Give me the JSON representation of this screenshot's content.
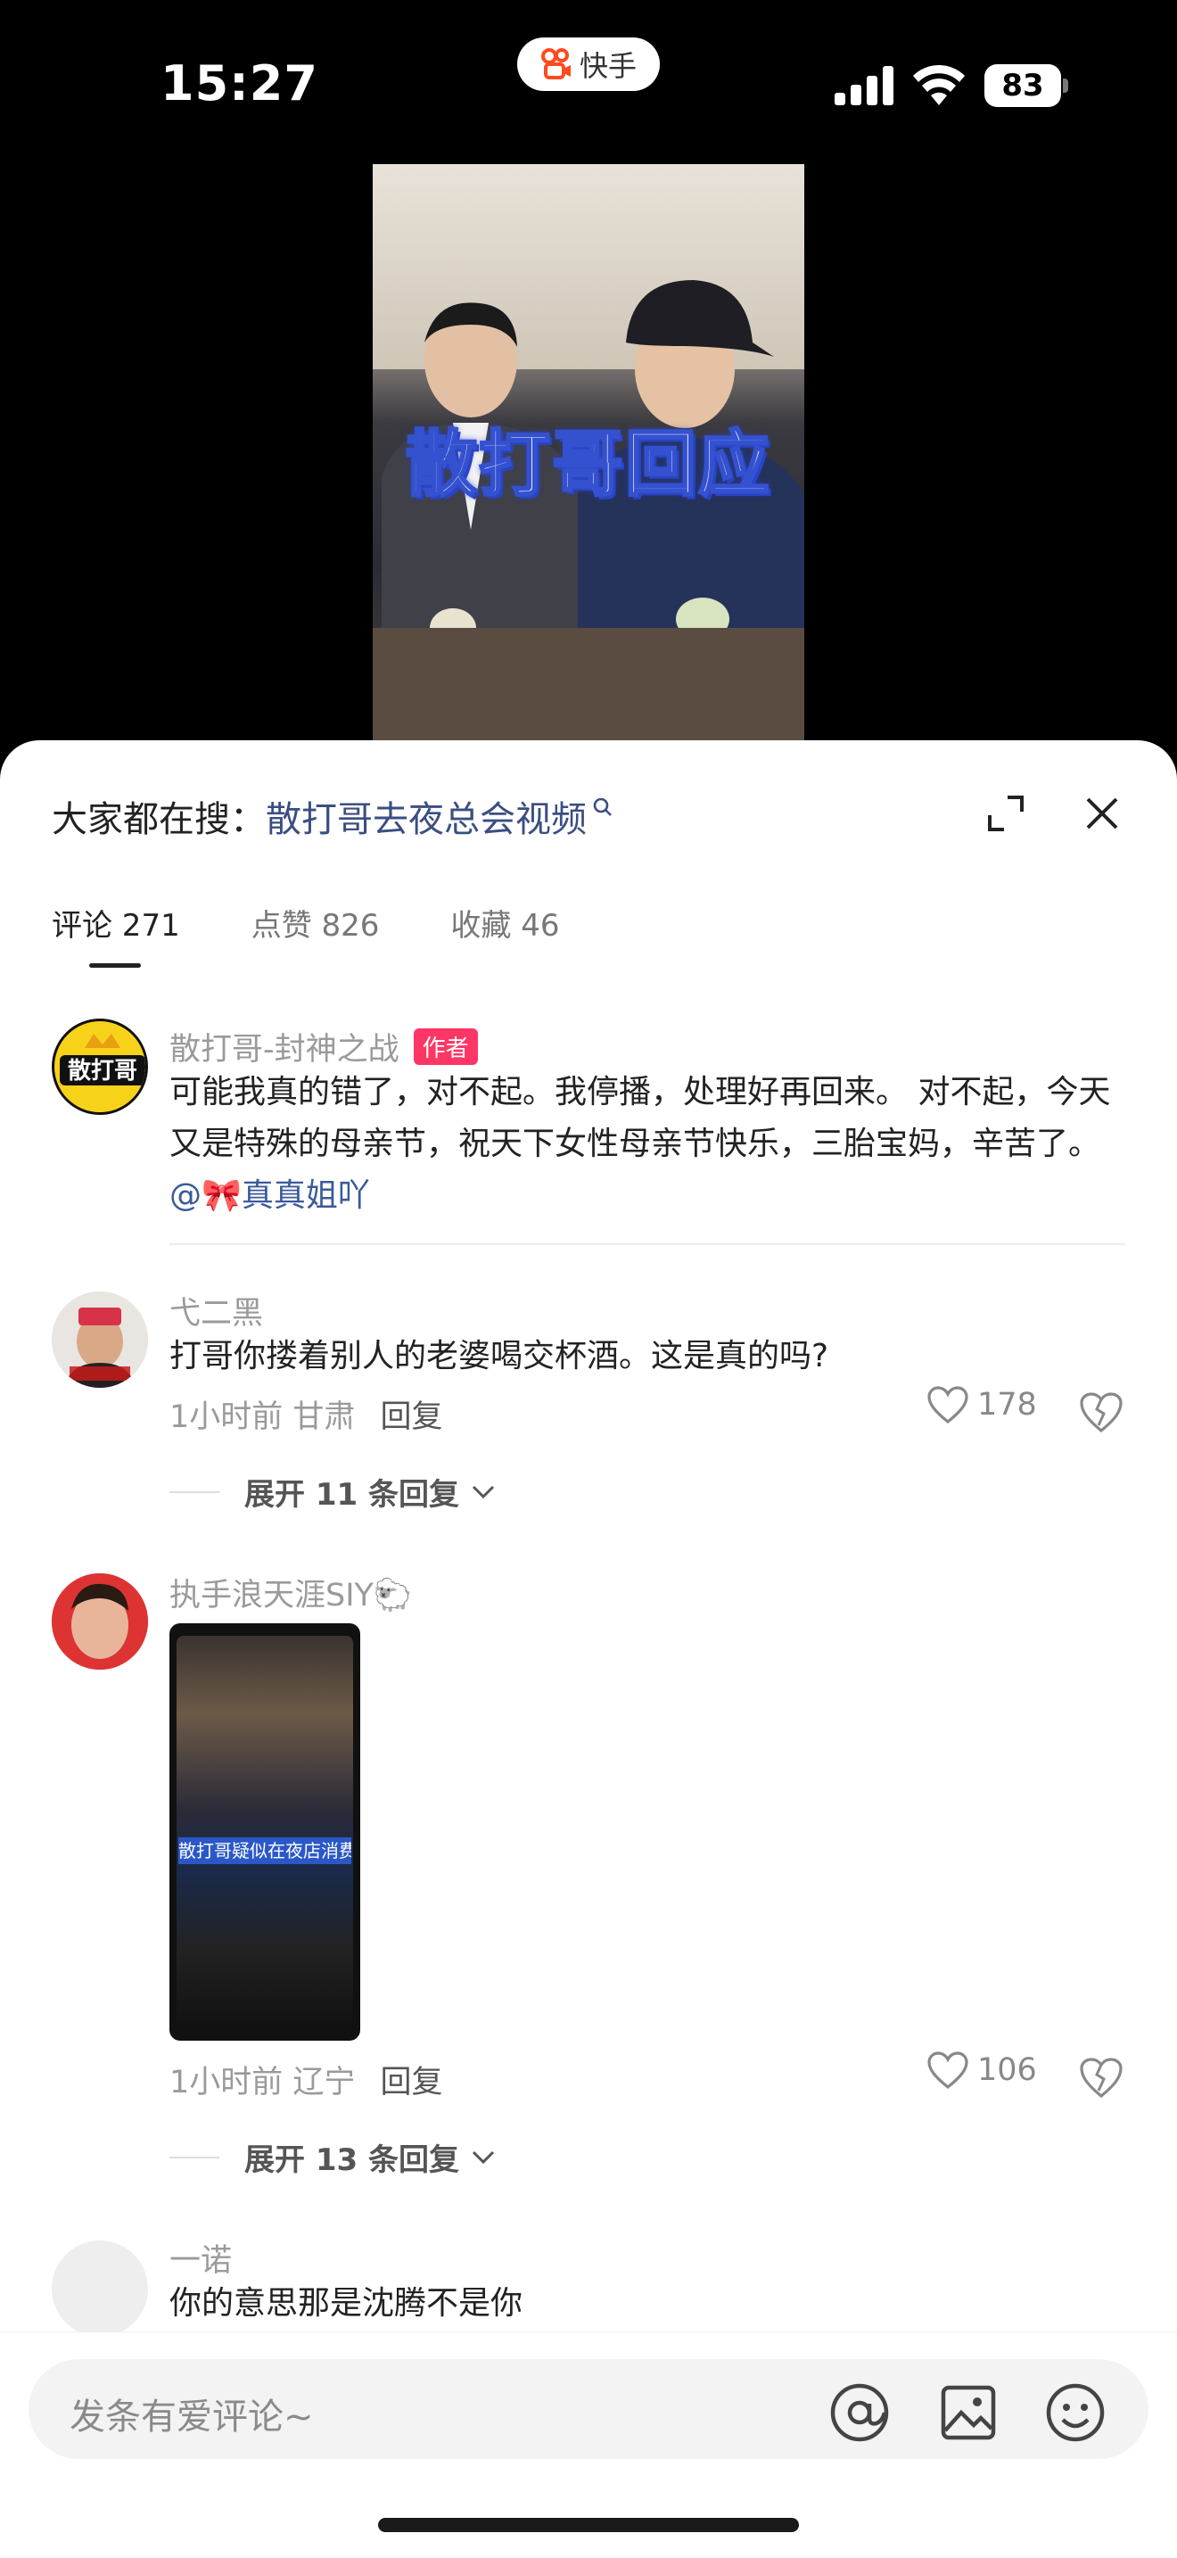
{
  "status_bar": {
    "time": "15:27",
    "app_name": "快手",
    "battery": "83"
  },
  "video": {
    "caption": "散打哥回应"
  },
  "sheet": {
    "search_prefix": "大家都在搜：",
    "search_term": "散打哥去夜总会视频",
    "tabs": [
      {
        "label": "评论 271"
      },
      {
        "label": "点赞 826"
      },
      {
        "label": "收藏 46"
      }
    ]
  },
  "comments": [
    {
      "name": "散打哥-封神之战",
      "badge": "作者",
      "avatar_text": "散打哥",
      "text": "可能我真的错了，对不起。我停播，处理好再回来。 对不起，今天又是特殊的母亲节，祝天下女性母亲节快乐，三胎宝妈，辛苦了。",
      "mention": "@🎀真真姐吖"
    },
    {
      "name": "弋二黑",
      "text": "打哥你搂着别人的老婆喝交杯酒。这是真的吗?",
      "time": "1小时前",
      "location": "甘肃",
      "reply_label": "回复",
      "likes": "178",
      "expand_label": "展开 11 条回复"
    },
    {
      "name": "执手浪天涯SIY🐑",
      "image_banner": "散打哥疑似在夜店消费",
      "time": "1小时前",
      "location": "辽宁",
      "reply_label": "回复",
      "likes": "106",
      "expand_label": "展开 13 条回复"
    },
    {
      "name": "一诺",
      "text": "你的意思那是沈腾不是你"
    }
  ],
  "input": {
    "placeholder": "发条有爱评论~"
  },
  "colors": {
    "author_badge": "#fe3666",
    "link": "#3b4e82",
    "caption_stroke": "#3451d0"
  },
  "icons": [
    "signal-icon",
    "wifi-icon",
    "battery-icon",
    "search-icon",
    "expand-icon",
    "close-icon",
    "heart-icon",
    "broken-heart-icon",
    "chevron-down-icon",
    "at-icon",
    "image-icon",
    "emoji-icon"
  ]
}
